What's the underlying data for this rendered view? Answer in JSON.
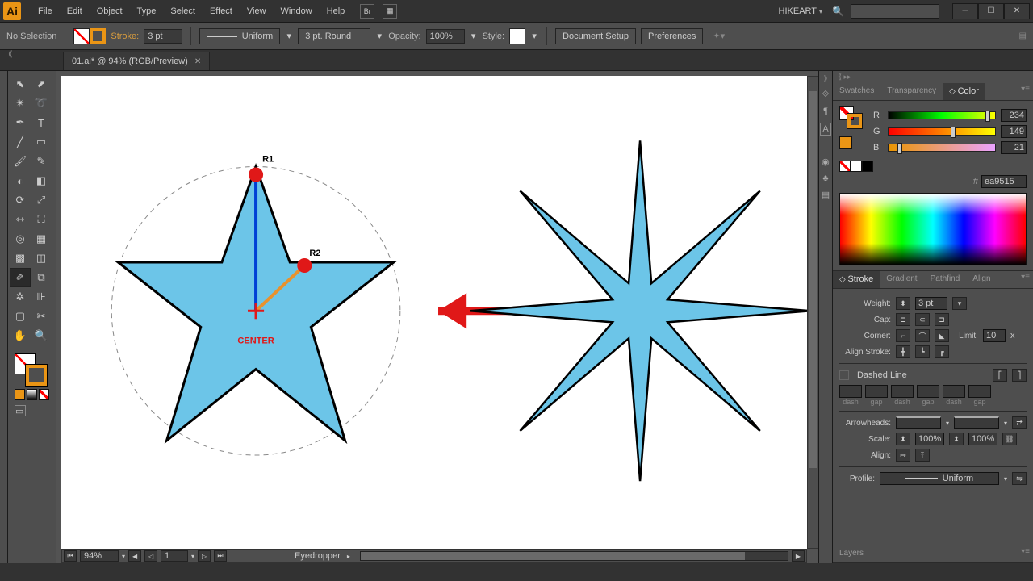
{
  "app": {
    "icon_label": "Ai"
  },
  "menubar": {
    "items": [
      "File",
      "Edit",
      "Object",
      "Type",
      "Select",
      "Effect",
      "View",
      "Window",
      "Help"
    ],
    "br_label": "Br",
    "user": "HIKEART",
    "search_placeholder": ""
  },
  "controlbar": {
    "selection": "No Selection",
    "stroke_label": "Stroke:",
    "stroke_weight": "3 pt",
    "brush": "Uniform",
    "width_profile": "3 pt. Round",
    "opacity_label": "Opacity:",
    "opacity": "100%",
    "style_label": "Style:",
    "doc_setup": "Document Setup",
    "prefs": "Preferences"
  },
  "doc_tab": {
    "name": "01.ai* @ 94% (RGB/Preview)"
  },
  "statusbar": {
    "zoom": "94%",
    "page": "1",
    "tool": "Eyedropper"
  },
  "artwork": {
    "r1": "R1",
    "r2": "R2",
    "center": "CENTER"
  },
  "panels": {
    "color_tabs": [
      "Swatches",
      "Transparency",
      "Color"
    ],
    "color": {
      "r_label": "R",
      "r": "234",
      "g_label": "G",
      "g": "149",
      "b_label": "B",
      "b": "21",
      "hex": "ea9515"
    },
    "stroke_tabs": [
      "Stroke",
      "Gradient",
      "Pathfind",
      "Align"
    ],
    "stroke": {
      "weight_label": "Weight:",
      "weight": "3 pt",
      "cap_label": "Cap:",
      "corner_label": "Corner:",
      "limit_label": "Limit:",
      "limit": "10",
      "x": "x",
      "align_label": "Align Stroke:",
      "dashed_label": "Dashed Line",
      "dash": "dash",
      "gap": "gap",
      "arrowheads_label": "Arrowheads:",
      "scale_label": "Scale:",
      "scale1": "100%",
      "scale2": "100%",
      "align2_label": "Align:",
      "profile_label": "Profile:",
      "profile": "Uniform"
    },
    "layers_tab": "Layers"
  }
}
